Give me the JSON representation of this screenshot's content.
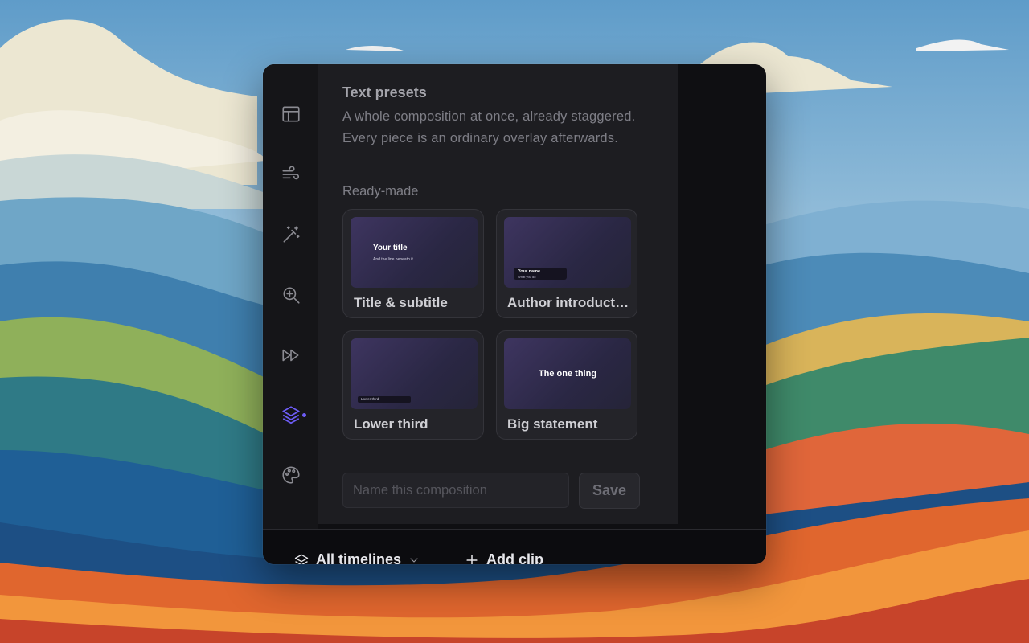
{
  "window": {
    "sidebar": {
      "items": [
        {
          "icon": "layout-icon",
          "active": false
        },
        {
          "icon": "wind-icon",
          "active": false
        },
        {
          "icon": "magic-wand-icon",
          "active": false
        },
        {
          "icon": "zoom-in-icon",
          "active": false
        },
        {
          "icon": "fast-forward-icon",
          "active": false
        },
        {
          "icon": "layers-icon",
          "active": true
        },
        {
          "icon": "palette-icon",
          "active": false
        }
      ],
      "active_color": "#6d5cf6"
    },
    "panel": {
      "title": "Text presets",
      "description": "A whole composition at once, already staggered. Every piece is an ordinary overlay afterwards.",
      "section_label": "Ready-made",
      "presets": [
        {
          "label": "Title & subtitle",
          "thumb": {
            "title": "Your title",
            "subtitle": "And the line beneath it"
          }
        },
        {
          "label": "Author introduction",
          "thumb": {
            "name": "Your name",
            "role": "What you do"
          }
        },
        {
          "label": "Lower third",
          "thumb": {
            "text": "Lower third"
          }
        },
        {
          "label": "Big statement",
          "thumb": {
            "text": "The one thing"
          }
        }
      ],
      "composition_name_placeholder": "Name this composition",
      "save_label": "Save"
    },
    "bottom_bar": {
      "timelines_label": "All timelines",
      "add_clip_label": "Add clip"
    }
  }
}
